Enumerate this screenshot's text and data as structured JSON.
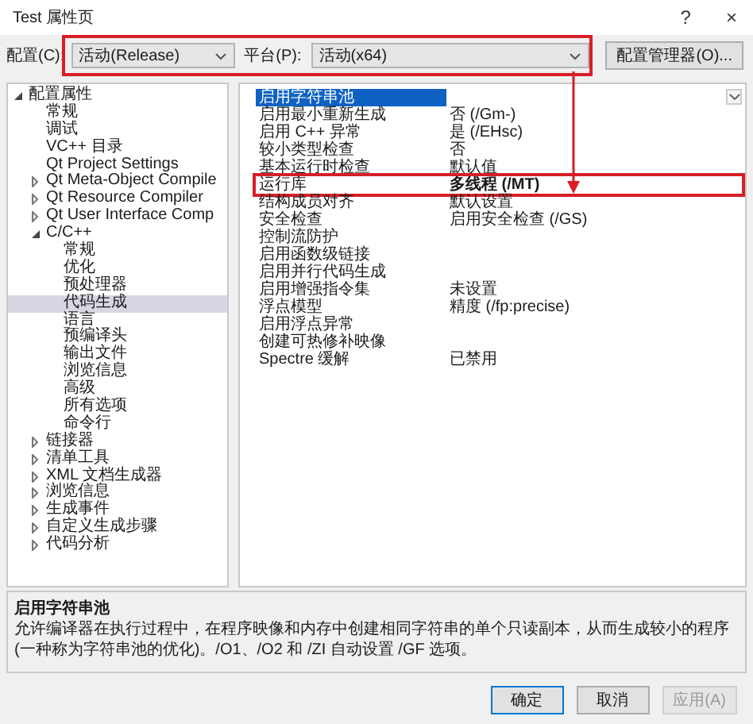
{
  "window": {
    "title": "Test 属性页",
    "help": "?",
    "close": "×"
  },
  "config_bar": {
    "outlined": true,
    "config_label": "配置(C):",
    "config_value": "活动(Release)",
    "platform_label": "平台(P):",
    "platform_value": "活动(x64)",
    "manager_button": "配置管理器(O)..."
  },
  "tree": [
    {
      "label": "配置属性",
      "expanded": true,
      "selected": false,
      "children": [
        {
          "label": "常规",
          "selected": false
        },
        {
          "label": "调试",
          "selected": false
        },
        {
          "label": "VC++ 目录",
          "selected": false
        },
        {
          "label": "Qt Project Settings",
          "selected": false
        },
        {
          "label": "Qt Meta-Object Compile",
          "selected": false,
          "expanded": false
        },
        {
          "label": "Qt Resource Compiler",
          "selected": false,
          "expanded": false
        },
        {
          "label": "Qt User Interface Comp",
          "selected": false,
          "expanded": false
        },
        {
          "label": "C/C++",
          "selected": false,
          "expanded": true,
          "children": [
            {
              "label": "常规",
              "selected": false
            },
            {
              "label": "优化",
              "selected": false
            },
            {
              "label": "预处理器",
              "selected": false
            },
            {
              "label": "代码生成",
              "selected": true
            },
            {
              "label": "语言",
              "selected": false
            },
            {
              "label": "预编译头",
              "selected": false
            },
            {
              "label": "输出文件",
              "selected": false
            },
            {
              "label": "浏览信息",
              "selected": false
            },
            {
              "label": "高级",
              "selected": false
            },
            {
              "label": "所有选项",
              "selected": false
            },
            {
              "label": "命令行",
              "selected": false
            }
          ]
        },
        {
          "label": "链接器",
          "selected": false,
          "expanded": false
        },
        {
          "label": "清单工具",
          "selected": false,
          "expanded": false
        },
        {
          "label": "XML 文档生成器",
          "selected": false,
          "expanded": false
        },
        {
          "label": "浏览信息",
          "selected": false,
          "expanded": false
        },
        {
          "label": "生成事件",
          "selected": false,
          "expanded": false
        },
        {
          "label": "自定义生成步骤",
          "selected": false,
          "expanded": false
        },
        {
          "label": "代码分析",
          "selected": false,
          "expanded": false
        }
      ]
    }
  ],
  "properties": [
    {
      "name": "启用字符串池",
      "selected": true,
      "outlined": false
    },
    {
      "name": "启用最小重新生成",
      "value": "否 (/Gm-)",
      "selected": false,
      "modified": false,
      "outlined": false
    },
    {
      "name": "启用 C++ 异常",
      "value": "是 (/EHsc)",
      "selected": false,
      "modified": false,
      "outlined": false
    },
    {
      "name": "较小类型检查",
      "value": "否",
      "selected": false,
      "modified": false,
      "outlined": false
    },
    {
      "name": "基本运行时检查",
      "value": "默认值",
      "selected": false,
      "modified": false,
      "outlined": false
    },
    {
      "name": "运行库",
      "value": "多线程 (/MT)",
      "selected": false,
      "modified": true,
      "outlined": true
    },
    {
      "name": "结构成员对齐",
      "value": "默认设置",
      "selected": false,
      "modified": false,
      "outlined": false
    },
    {
      "name": "安全检查",
      "value": "启用安全检查 (/GS)",
      "selected": false,
      "modified": false,
      "outlined": false
    },
    {
      "name": "控制流防护",
      "selected": false,
      "outlined": false
    },
    {
      "name": "启用函数级链接",
      "selected": false,
      "outlined": false
    },
    {
      "name": "启用并行代码生成",
      "selected": false,
      "outlined": false
    },
    {
      "name": "启用增强指令集",
      "value": "未设置",
      "selected": false,
      "modified": false,
      "outlined": false
    },
    {
      "name": "浮点模型",
      "value": "精度 (/fp:precise)",
      "selected": false,
      "modified": false,
      "outlined": false
    },
    {
      "name": "启用浮点异常",
      "selected": false,
      "outlined": false
    },
    {
      "name": "创建可热修补映像",
      "selected": false,
      "outlined": false
    },
    {
      "name": "Spectre 缓解",
      "value": "已禁用",
      "selected": false,
      "modified": false,
      "outlined": false
    }
  ],
  "description": {
    "title": "启用字符串池",
    "text": "允许编译器在执行过程中，在程序映像和内存中创建相同字符串的单个只读副本，从而生成较小的程序(一种称为字符串池的优化)。/O1、/O2 和 /ZI 自动设置 /GF 选项。"
  },
  "buttons": [
    {
      "label": "确定",
      "default": true,
      "disabled": false
    },
    {
      "label": "取消",
      "default": false,
      "disabled": false
    },
    {
      "label": "应用(A)",
      "default": false,
      "disabled": true
    }
  ]
}
